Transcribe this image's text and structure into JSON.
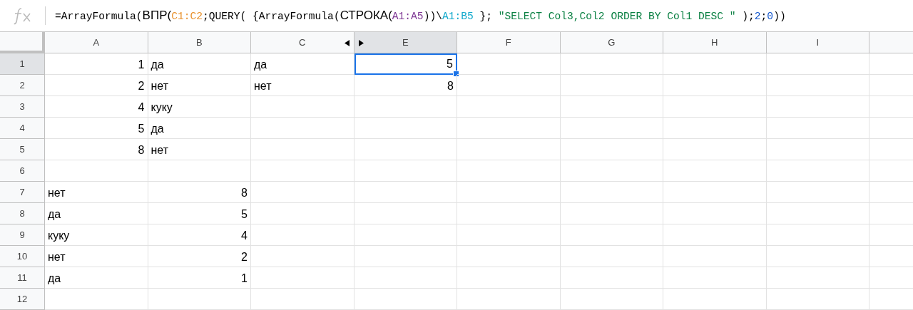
{
  "formula_bar": {
    "tokens": [
      {
        "kind": "plain",
        "text": "=ArrayFormula("
      },
      {
        "kind": "name",
        "text": "ВПР("
      },
      {
        "kind": "range",
        "text": "C1:C2",
        "color": "#e8912d"
      },
      {
        "kind": "plain",
        "text": ";QUERY( {ArrayFormula("
      },
      {
        "kind": "name",
        "text": "СТРОКА("
      },
      {
        "kind": "range",
        "text": "A1:A5",
        "color": "#7e3794"
      },
      {
        "kind": "plain",
        "text": "))\\"
      },
      {
        "kind": "range",
        "text": "A1:B5",
        "color": "#11a9cc"
      },
      {
        "kind": "plain",
        "text": " }; "
      },
      {
        "kind": "string",
        "text": "\"SELECT Col3,Col2 ORDER BY Col1 DESC \""
      },
      {
        "kind": "plain",
        "text": " );"
      },
      {
        "kind": "number",
        "text": "2"
      },
      {
        "kind": "plain",
        "text": ";"
      },
      {
        "kind": "number",
        "text": "0"
      },
      {
        "kind": "plain",
        "text": "))"
      }
    ]
  },
  "columns": [
    {
      "label": "A"
    },
    {
      "label": "B"
    },
    {
      "label": "C",
      "hidden_after": true
    },
    {
      "label": "E"
    },
    {
      "label": "F"
    },
    {
      "label": "G"
    },
    {
      "label": "H"
    },
    {
      "label": "I"
    }
  ],
  "rows": [
    {
      "header": "1",
      "cells": [
        {
          "kind": "number",
          "text": "1",
          "selected": false
        },
        {
          "kind": "text",
          "text": "да",
          "selected": false
        },
        {
          "kind": "text",
          "text": "да",
          "selected": false
        },
        {
          "kind": "number",
          "text": "5",
          "selected": true
        },
        {
          "kind": "empty",
          "selected": false
        },
        {
          "kind": "empty",
          "selected": false
        },
        {
          "kind": "empty",
          "selected": false
        },
        {
          "kind": "empty",
          "selected": false
        }
      ]
    },
    {
      "header": "2",
      "cells": [
        {
          "kind": "number",
          "text": "2",
          "selected": false
        },
        {
          "kind": "text",
          "text": "нет",
          "selected": false
        },
        {
          "kind": "text",
          "text": "нет",
          "selected": false
        },
        {
          "kind": "number",
          "text": "8",
          "selected": false
        },
        {
          "kind": "empty",
          "selected": false
        },
        {
          "kind": "empty",
          "selected": false
        },
        {
          "kind": "empty",
          "selected": false
        },
        {
          "kind": "empty",
          "selected": false
        }
      ]
    },
    {
      "header": "3",
      "cells": [
        {
          "kind": "number",
          "text": "4",
          "selected": false
        },
        {
          "kind": "text",
          "text": "куку",
          "selected": false
        },
        {
          "kind": "empty",
          "selected": false
        },
        {
          "kind": "empty",
          "selected": false
        },
        {
          "kind": "empty",
          "selected": false
        },
        {
          "kind": "empty",
          "selected": false
        },
        {
          "kind": "empty",
          "selected": false
        },
        {
          "kind": "empty",
          "selected": false
        }
      ]
    },
    {
      "header": "4",
      "cells": [
        {
          "kind": "number",
          "text": "5",
          "selected": false
        },
        {
          "kind": "text",
          "text": "да",
          "selected": false
        },
        {
          "kind": "empty",
          "selected": false
        },
        {
          "kind": "empty",
          "selected": false
        },
        {
          "kind": "empty",
          "selected": false
        },
        {
          "kind": "empty",
          "selected": false
        },
        {
          "kind": "empty",
          "selected": false
        },
        {
          "kind": "empty",
          "selected": false
        }
      ]
    },
    {
      "header": "5",
      "cells": [
        {
          "kind": "number",
          "text": "8",
          "selected": false
        },
        {
          "kind": "text",
          "text": "нет",
          "selected": false
        },
        {
          "kind": "empty",
          "selected": false
        },
        {
          "kind": "empty",
          "selected": false
        },
        {
          "kind": "empty",
          "selected": false
        },
        {
          "kind": "empty",
          "selected": false
        },
        {
          "kind": "empty",
          "selected": false
        },
        {
          "kind": "empty",
          "selected": false
        }
      ]
    },
    {
      "header": "6",
      "cells": [
        {
          "kind": "empty",
          "selected": false
        },
        {
          "kind": "empty",
          "selected": false
        },
        {
          "kind": "empty",
          "selected": false
        },
        {
          "kind": "empty",
          "selected": false
        },
        {
          "kind": "empty",
          "selected": false
        },
        {
          "kind": "empty",
          "selected": false
        },
        {
          "kind": "empty",
          "selected": false
        },
        {
          "kind": "empty",
          "selected": false
        }
      ]
    },
    {
      "header": "7",
      "cells": [
        {
          "kind": "text",
          "text": "нет",
          "selected": false
        },
        {
          "kind": "number",
          "text": "8",
          "selected": false
        },
        {
          "kind": "empty",
          "selected": false
        },
        {
          "kind": "empty",
          "selected": false
        },
        {
          "kind": "empty",
          "selected": false
        },
        {
          "kind": "empty",
          "selected": false
        },
        {
          "kind": "empty",
          "selected": false
        },
        {
          "kind": "empty",
          "selected": false
        }
      ]
    },
    {
      "header": "8",
      "cells": [
        {
          "kind": "text",
          "text": "да",
          "selected": false
        },
        {
          "kind": "number",
          "text": "5",
          "selected": false
        },
        {
          "kind": "empty",
          "selected": false
        },
        {
          "kind": "empty",
          "selected": false
        },
        {
          "kind": "empty",
          "selected": false
        },
        {
          "kind": "empty",
          "selected": false
        },
        {
          "kind": "empty",
          "selected": false
        },
        {
          "kind": "empty",
          "selected": false
        }
      ]
    },
    {
      "header": "9",
      "cells": [
        {
          "kind": "text",
          "text": "куку",
          "selected": false
        },
        {
          "kind": "number",
          "text": "4",
          "selected": false
        },
        {
          "kind": "empty",
          "selected": false
        },
        {
          "kind": "empty",
          "selected": false
        },
        {
          "kind": "empty",
          "selected": false
        },
        {
          "kind": "empty",
          "selected": false
        },
        {
          "kind": "empty",
          "selected": false
        },
        {
          "kind": "empty",
          "selected": false
        }
      ]
    },
    {
      "header": "10",
      "cells": [
        {
          "kind": "text",
          "text": "нет",
          "selected": false
        },
        {
          "kind": "number",
          "text": "2",
          "selected": false
        },
        {
          "kind": "empty",
          "selected": false
        },
        {
          "kind": "empty",
          "selected": false
        },
        {
          "kind": "empty",
          "selected": false
        },
        {
          "kind": "empty",
          "selected": false
        },
        {
          "kind": "empty",
          "selected": false
        },
        {
          "kind": "empty",
          "selected": false
        }
      ]
    },
    {
      "header": "11",
      "cells": [
        {
          "kind": "text",
          "text": "да",
          "selected": false
        },
        {
          "kind": "number",
          "text": "1",
          "selected": false
        },
        {
          "kind": "empty",
          "selected": false
        },
        {
          "kind": "empty",
          "selected": false
        },
        {
          "kind": "empty",
          "selected": false
        },
        {
          "kind": "empty",
          "selected": false
        },
        {
          "kind": "empty",
          "selected": false
        },
        {
          "kind": "empty",
          "selected": false
        }
      ]
    },
    {
      "header": "12",
      "cells": [
        {
          "kind": "empty",
          "selected": false
        },
        {
          "kind": "empty",
          "selected": false
        },
        {
          "kind": "empty",
          "selected": false
        },
        {
          "kind": "empty",
          "selected": false
        },
        {
          "kind": "empty",
          "selected": false
        },
        {
          "kind": "empty",
          "selected": false
        },
        {
          "kind": "empty",
          "selected": false
        },
        {
          "kind": "empty",
          "selected": false
        }
      ]
    }
  ]
}
